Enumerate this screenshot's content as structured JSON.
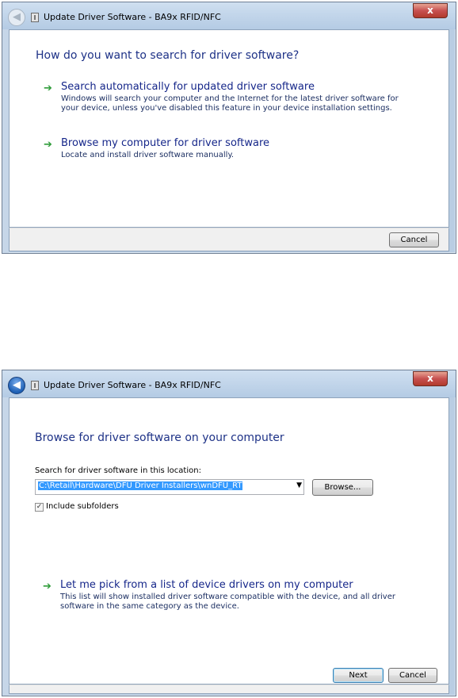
{
  "window1": {
    "title": "Update Driver Software - BA9x RFID/NFC",
    "close_glyph": "x",
    "back_glyph": "◀",
    "heading": "How do you want to search for driver software?",
    "options": [
      {
        "title": "Search automatically for updated driver software",
        "desc": "Windows will search your computer and the Internet for the latest driver software for your device, unless you've disabled this feature in your device installation settings."
      },
      {
        "title": "Browse my computer for driver software",
        "desc": "Locate and install driver software manually."
      }
    ],
    "cancel_label": "Cancel"
  },
  "window2": {
    "title": "Update Driver Software - BA9x RFID/NFC",
    "close_glyph": "x",
    "back_glyph": "◀",
    "heading": "Browse for driver software on your computer",
    "search_label": "Search for driver software in this location:",
    "path_value": "C:\\Retail\\Hardware\\DFU Driver Installers\\wnDFU_RT",
    "combo_arrow": "▼",
    "browse_label": "Browse...",
    "include_subfolders_label": "Include subfolders",
    "include_subfolders_checked": true,
    "check_glyph": "✓",
    "pick_title": "Let me pick from a list of device drivers on my computer",
    "pick_desc": "This list will show installed driver software compatible with the device, and all driver software in the same category as the device.",
    "next_label": "Next",
    "cancel_label": "Cancel"
  },
  "arrow_glyph": "➔",
  "colors": {
    "heading": "#1e3287",
    "link": "#16278a",
    "arrow": "#2f9c3a",
    "selection": "#3399ff"
  },
  "icons": {
    "window_back": "back-arrow-icon",
    "device": "device-icon",
    "close": "close-icon",
    "option_arrow": "green-arrow-icon"
  }
}
